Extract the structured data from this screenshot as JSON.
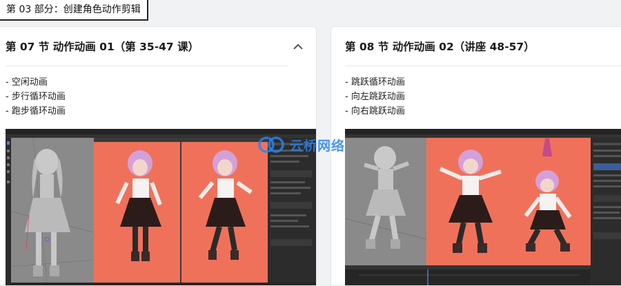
{
  "section": {
    "label": "第 03 部分：创建角色动作剪辑"
  },
  "cards": [
    {
      "title": "第 07 节 动作动画 01（第 35-47 课）",
      "expanded": true,
      "collapse_icon": "chevron-up-icon",
      "items": [
        "- 空闲动画",
        "- 步行循环动画",
        "- 跑步循环动画"
      ],
      "preview": {
        "viewport_bg": "#f0715a",
        "panel_bg": "#2c2c2c"
      }
    },
    {
      "title": "第 08 节 动作动画 02（讲座 48-57）",
      "items": [
        "- 跳跃循环动画",
        "- 向左跳跃动画",
        "- 向右跳跃动画"
      ],
      "preview": {
        "viewport_bg": "#f0715a",
        "panel_bg": "#2c2c2c"
      }
    }
  ],
  "watermark": {
    "text": "云桥网络",
    "logo_icon": "cloud-link-logo-icon",
    "color": "#2882eb"
  }
}
